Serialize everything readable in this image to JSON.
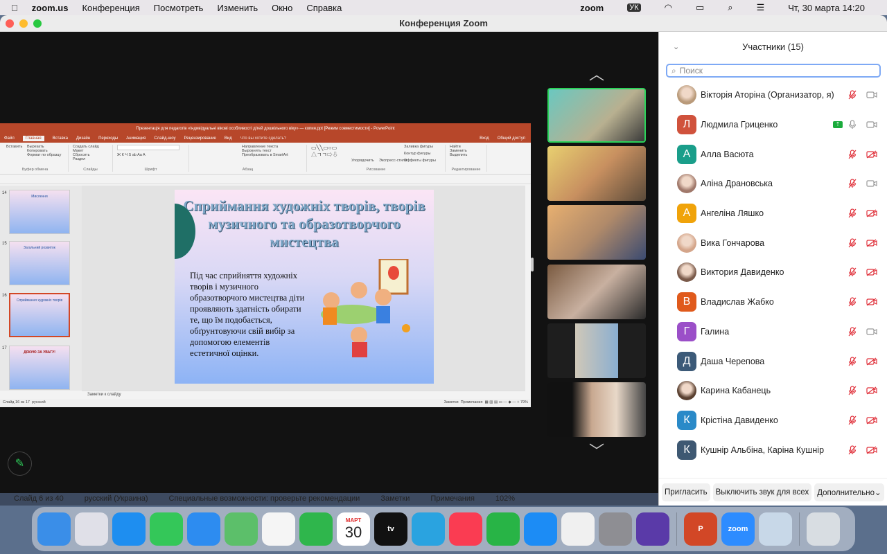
{
  "menubar": {
    "app": "zoom.us",
    "items": [
      "Конференция",
      "Посмотреть",
      "Изменить",
      "Окно",
      "Справка"
    ],
    "right": {
      "zoom_label": "zoom",
      "input_lang": "УК",
      "datetime": "Чт, 30 марта  14:20"
    }
  },
  "window": {
    "title": "Конференция Zoom"
  },
  "ppt": {
    "title": "Презентація для педагогів «Індивідуальні вікові особливості дітей дошкільного віку» — копия.ppt [Режим совместимости] - PowerPoint",
    "tabs": [
      "Файл",
      "Главная",
      "Вставка",
      "Дизайн",
      "Переходы",
      "Анимация",
      "Слайд-шоу",
      "Рецензирование",
      "Вид",
      "Что вы хотите сделать?",
      "Вход",
      "Общий доступ"
    ],
    "groups": [
      "Буфер обмена",
      "Слайды",
      "Шрифт",
      "Абзац",
      "Рисование",
      "Редактирование"
    ],
    "ribbon_items": [
      "Вставить",
      "Вырезать",
      "Копировать",
      "Формат по образцу",
      "Создать слайд",
      "Макет",
      "Сбросить",
      "Раздел",
      "Направление текста",
      "Выровнять текст",
      "Преобразовать в SmartArt",
      "Упорядочить",
      "Экспресс-стили",
      "Заливка фигуры",
      "Контур фигуры",
      "Эффекты фигуры",
      "Найти",
      "Заменить",
      "Выделить"
    ],
    "thumbs": [
      {
        "num": "14",
        "title": "Мислення"
      },
      {
        "num": "15",
        "title": "Загальний розвиток"
      },
      {
        "num": "16",
        "title": "Сприймання художніх творів"
      },
      {
        "num": "17",
        "title": "ДЯКУЮ ЗА УВАГУ!"
      }
    ],
    "slide": {
      "title": "Сприймання художніх творів, творів музичного та образотворчого мистецтва",
      "body": "Під час сприйняття художніх творів і музичного образотворчого мистецтва діти проявляють здатність обирати те, що їм подобається, обґрунтовуючи свій вибір за допомогою елементів естетичної оцінки."
    },
    "notes_placeholder": "Заметки к слайду",
    "status": {
      "slide": "Слайд 16 из 17",
      "lang": "русский",
      "notes": "Заметки",
      "comments": "Примечания",
      "zoom": "79%"
    }
  },
  "participants": {
    "title": "Участники (15)",
    "search_placeholder": "Поиск",
    "list": [
      {
        "name": "Вікторія Аторіна (Организатор, я)",
        "initial": "",
        "color": "#b99a7a",
        "mic": "muted",
        "cam": "on"
      },
      {
        "name": "Людмила Гриценко",
        "initial": "Л",
        "color": "#d0523c",
        "mic": "on",
        "cam": "on",
        "sharing": true
      },
      {
        "name": "Алла Васюта",
        "initial": "А",
        "color": "#1a9e8a",
        "mic": "muted",
        "cam": "off"
      },
      {
        "name": "Аліна Драновська",
        "initial": "",
        "color": "#a0786a",
        "mic": "muted",
        "cam": "on"
      },
      {
        "name": "Ангеліна Ляшко",
        "initial": "А",
        "color": "#f0a30a",
        "mic": "muted",
        "cam": "off"
      },
      {
        "name": "Вика Гончарова",
        "initial": "",
        "color": "#d4a58a",
        "mic": "muted",
        "cam": "off"
      },
      {
        "name": "Виктория Давиденко",
        "initial": "",
        "color": "#7a5a4a",
        "mic": "muted",
        "cam": "off"
      },
      {
        "name": "Владислав  Жабко",
        "initial": "В",
        "color": "#e05a1c",
        "mic": "muted",
        "cam": "off"
      },
      {
        "name": "Галина",
        "initial": "Г",
        "color": "#9b4fc8",
        "mic": "muted",
        "cam": "on"
      },
      {
        "name": "Даша Черепова",
        "initial": "Д",
        "color": "#3c5a78",
        "mic": "muted",
        "cam": "off"
      },
      {
        "name": "Карина Кабанець",
        "initial": "",
        "color": "#5a4030",
        "mic": "muted",
        "cam": "off"
      },
      {
        "name": "Крістіна Давиденко",
        "initial": "К",
        "color": "#2a8ac8",
        "mic": "muted",
        "cam": "off"
      },
      {
        "name": "Кушнір Альбіна, Каріна Кушнір",
        "initial": "К",
        "color": "#3e5872",
        "mic": "muted",
        "cam": "off"
      }
    ],
    "footer": {
      "invite": "Пригласить",
      "mute_all": "Выключить звук для всех",
      "more": "Дополнительно"
    }
  },
  "behind_status": {
    "slide": "Слайд 6 из 40",
    "lang": "русский (Украина)",
    "access": "Специальные возможности: проверьте рекомендации",
    "notes": "Заметки",
    "comments": "Примечания",
    "zoom": "102%"
  },
  "dock": [
    {
      "name": "Finder",
      "color": "#3a8ee8"
    },
    {
      "name": "Launchpad",
      "color": "#e0e0e8"
    },
    {
      "name": "Safari",
      "color": "#1e8ef0"
    },
    {
      "name": "Messages",
      "color": "#34c759"
    },
    {
      "name": "Mail",
      "color": "#2d8cf0"
    },
    {
      "name": "Maps",
      "color": "#5cbf6a"
    },
    {
      "name": "Photos",
      "color": "#f5f5f5"
    },
    {
      "name": "FaceTime",
      "color": "#2fb64c"
    },
    {
      "name": "Calendar",
      "color": "#ffffff",
      "label_month": "МАРТ",
      "label_day": "30"
    },
    {
      "name": "TV",
      "color": "#111111",
      "label": "tv"
    },
    {
      "name": "Telegram",
      "color": "#2aa3e0"
    },
    {
      "name": "Music",
      "color": "#fa3c52"
    },
    {
      "name": "Numbers",
      "color": "#28b446"
    },
    {
      "name": "App Store",
      "color": "#1c8cf5"
    },
    {
      "name": "Chrome",
      "color": "#f0f0f0"
    },
    {
      "name": "System Settings",
      "color": "#8e8e93"
    },
    {
      "name": "Clock",
      "color": "#5a3aa8"
    },
    {
      "name": "PowerPoint",
      "color": "#d24726",
      "label": "P"
    },
    {
      "name": "Zoom",
      "color": "#2d8cff",
      "label": "zoom"
    },
    {
      "name": "Preview",
      "color": "#c8d8e8"
    },
    {
      "name": "Trash",
      "color": "#d8dde2"
    }
  ]
}
